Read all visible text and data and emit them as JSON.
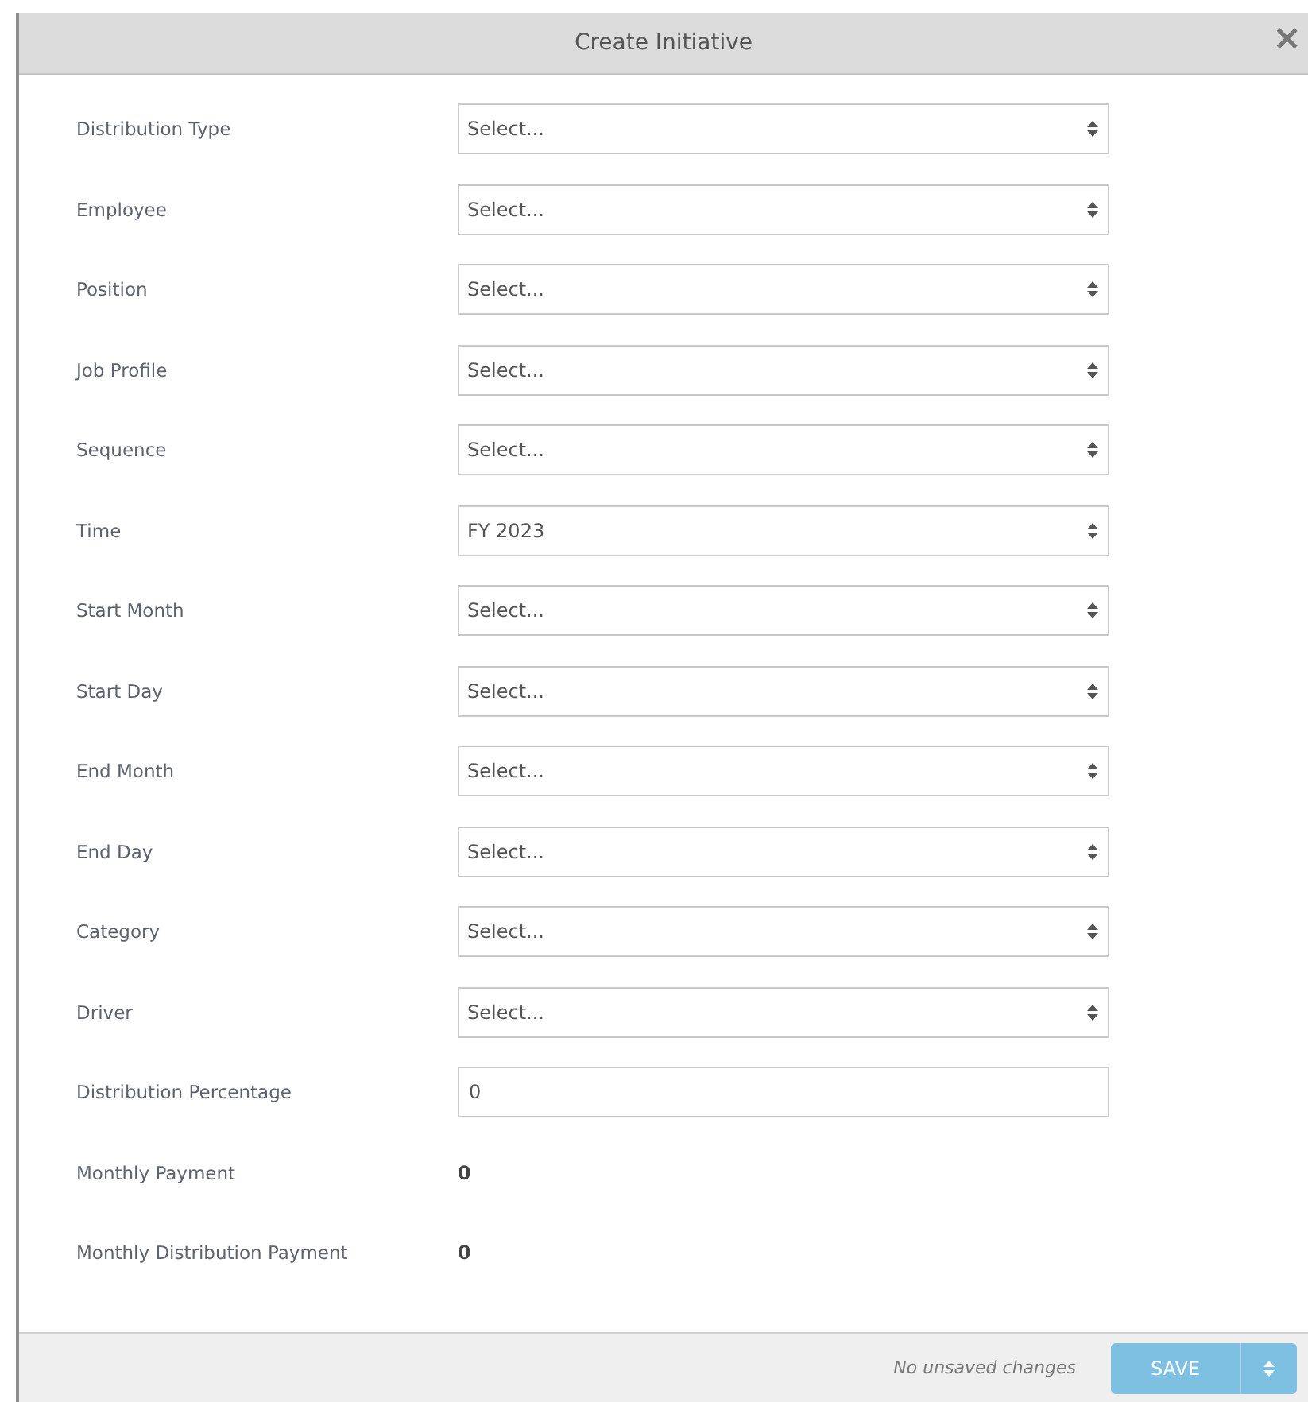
{
  "dialog": {
    "title": "Create Initiative",
    "close": "×"
  },
  "fields": [
    {
      "label": "Distribution Type",
      "kind": "select",
      "value": "Select..."
    },
    {
      "label": "Employee",
      "kind": "select",
      "value": "Select..."
    },
    {
      "label": "Position",
      "kind": "select",
      "value": "Select..."
    },
    {
      "label": "Job Profile",
      "kind": "select",
      "value": "Select..."
    },
    {
      "label": "Sequence",
      "kind": "select",
      "value": "Select..."
    },
    {
      "label": "Time",
      "kind": "select",
      "value": "FY 2023"
    },
    {
      "label": "Start Month",
      "kind": "select",
      "value": "Select..."
    },
    {
      "label": "Start Day",
      "kind": "select",
      "value": "Select..."
    },
    {
      "label": "End Month",
      "kind": "select",
      "value": "Select..."
    },
    {
      "label": "End Day",
      "kind": "select",
      "value": "Select..."
    },
    {
      "label": "Category",
      "kind": "select",
      "value": "Select..."
    },
    {
      "label": "Driver",
      "kind": "select",
      "value": "Select..."
    },
    {
      "label": "Distribution Percentage",
      "kind": "text",
      "value": "0"
    },
    {
      "label": "Monthly Payment",
      "kind": "value",
      "value": "0"
    },
    {
      "label": "Monthly Distribution Payment",
      "kind": "value",
      "value": "0"
    }
  ],
  "footer": {
    "status": "No unsaved changes",
    "save": "SAVE"
  }
}
